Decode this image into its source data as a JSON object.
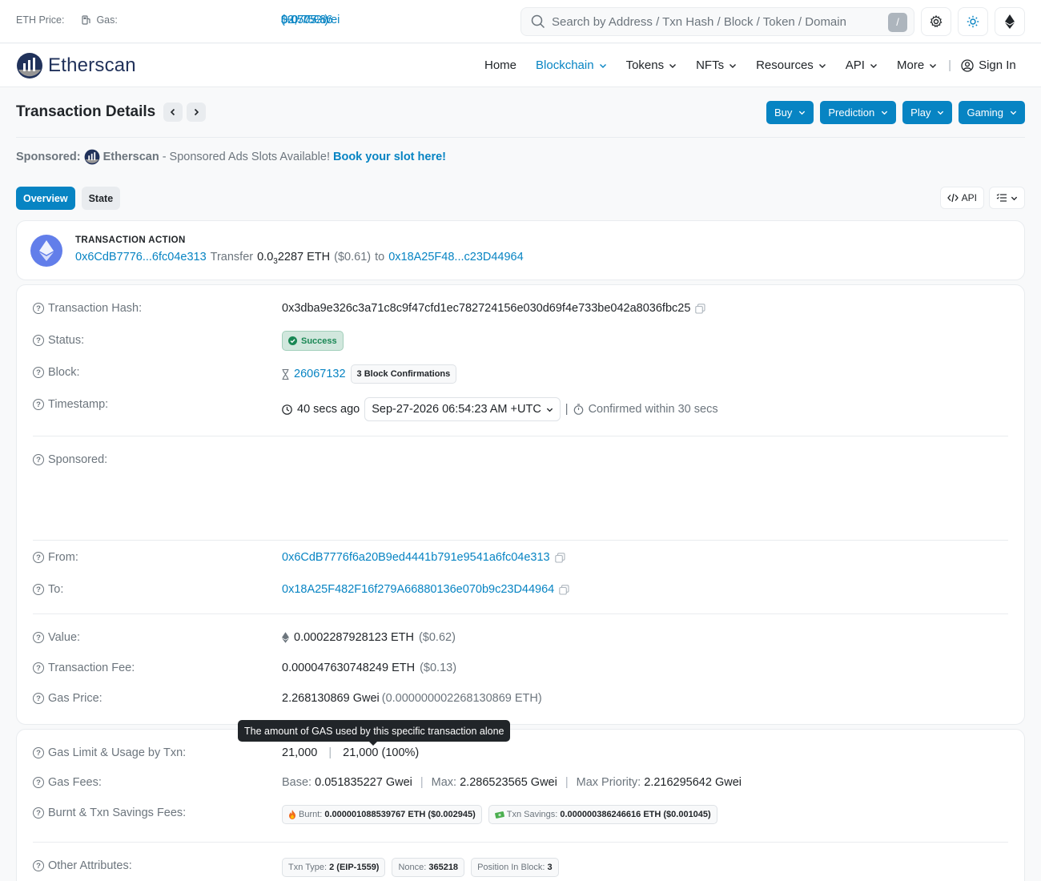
{
  "topbar": {
    "eth_price_label": "ETH Price:",
    "eth_price_value": "$2,705.86",
    "eth_price_change": "(+0.75%)",
    "gas_label": "Gas:",
    "gas_value": "0.057 Gwei",
    "search_placeholder": "Search by Address / Txn Hash / Block / Token / Domain",
    "search_shortcut": "/"
  },
  "nav": {
    "brand": "Etherscan",
    "items": [
      {
        "label": "Home"
      },
      {
        "label": "Blockchain"
      },
      {
        "label": "Tokens"
      },
      {
        "label": "NFTs"
      },
      {
        "label": "Resources"
      },
      {
        "label": "API"
      },
      {
        "label": "More"
      }
    ],
    "sign_in": "Sign In"
  },
  "header": {
    "title": "Transaction Details",
    "buttons": [
      "Buy",
      "Prediction",
      "Play",
      "Gaming"
    ]
  },
  "sponsored": {
    "label": "Sponsored:",
    "brand": "Etherscan",
    "text": "- Sponsored Ads Slots Available!",
    "link": "Book your slot here!"
  },
  "tabs": {
    "overview": "Overview",
    "state": "State",
    "api": "API"
  },
  "action": {
    "title": "TRANSACTION ACTION",
    "from": "0x6CdB7776...6fc04e313",
    "verb": "Transfer",
    "amount_main": "0.0",
    "amount_sub": "3",
    "amount_rest": "2287 ETH",
    "usd": "($0.61)",
    "to_word": "to",
    "to": "0x18A25F48...c23D44964"
  },
  "details": {
    "tx_hash_label": "Transaction Hash:",
    "tx_hash": "0x3dba9e326c3a71c8c9f47cfd1ec782724156e030d69f4e733be042a8036fbc25",
    "status_label": "Status:",
    "status": "Success",
    "block_label": "Block:",
    "block": "26067132",
    "confirmations": "3 Block Confirmations",
    "timestamp_label": "Timestamp:",
    "age": "40 secs ago",
    "timestamp": "Sep-27-2026 06:54:23 AM +UTC",
    "confirmed": "Confirmed within 30 secs",
    "sponsored_label": "Sponsored:",
    "from_label": "From:",
    "from": "0x6CdB7776f6a20B9ed4441b791e9541a6fc04e313",
    "to_label": "To:",
    "to": "0x18A25F482F16f279A66880136e070b9c23D44964",
    "value_label": "Value:",
    "value": "0.0002287928123 ETH",
    "value_usd": "($0.62)",
    "fee_label": "Transaction Fee:",
    "fee": "0.000047630748249 ETH",
    "fee_usd": "($0.13)",
    "gas_price_label": "Gas Price:",
    "gas_price": "2.268130869 Gwei",
    "gas_price_eth": "(0.000000002268130869 ETH)"
  },
  "gas": {
    "tooltip": "The amount of GAS used by this specific transaction alone",
    "limit_label": "Gas Limit & Usage by Txn:",
    "limit": "21,000",
    "usage": "21,000 (100%)",
    "fees_label": "Gas Fees:",
    "base_label": "Base:",
    "base": "0.051835227 Gwei",
    "max_label": "Max:",
    "max": "2.286523565 Gwei",
    "max_priority_label": "Max Priority:",
    "max_priority": "2.216295642 Gwei",
    "burnt_label": "Burnt & Txn Savings Fees:",
    "burnt_key": "Burnt:",
    "burnt": "0.000001088539767 ETH ($0.002945)",
    "savings_key": "Txn Savings:",
    "savings": "0.000000386246616 ETH ($0.001045)",
    "other_label": "Other Attributes:",
    "txn_type_key": "Txn Type:",
    "txn_type": "2 (EIP-1559)",
    "nonce_key": "Nonce:",
    "nonce": "365218",
    "position_key": "Position In Block:",
    "position": "3"
  },
  "colors": {
    "accent": "#0784c3",
    "success": "#198754",
    "eth": "#627eea"
  }
}
